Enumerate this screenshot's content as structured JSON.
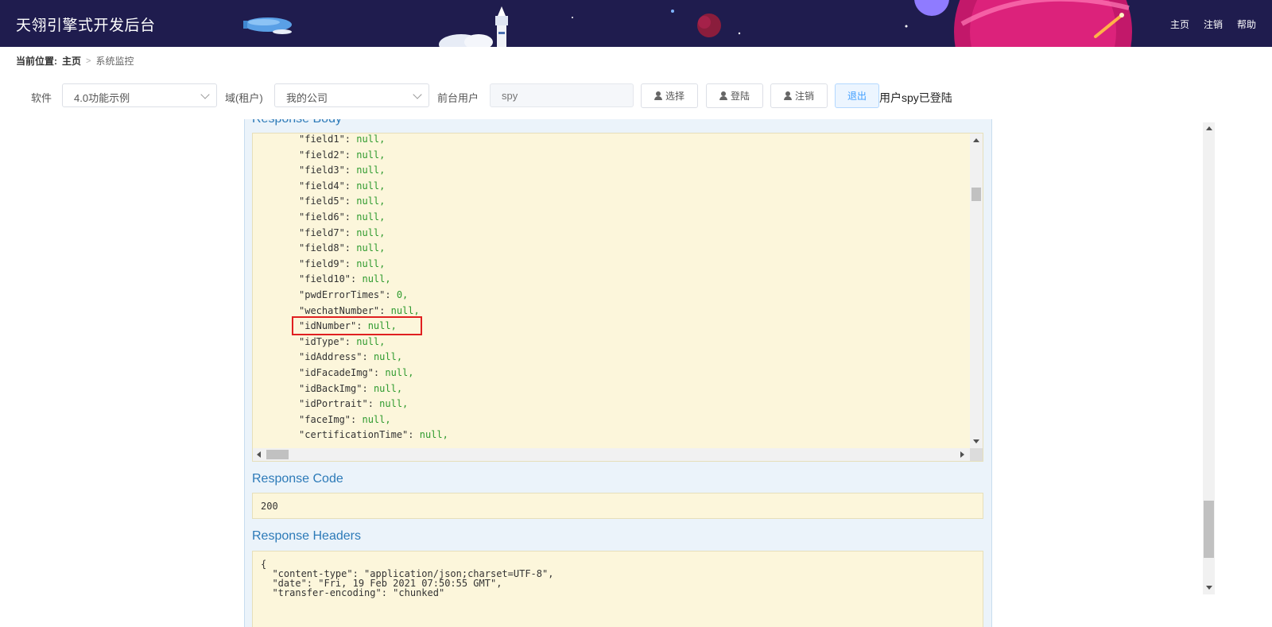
{
  "header": {
    "title": "天翎引擎式开发后台",
    "nav": [
      "主页",
      "注销",
      "帮助"
    ],
    "bg_color": "#1f1c4e"
  },
  "breadcrumb": {
    "prefix": "当前位置:",
    "home": "主页",
    "current": "系统监控"
  },
  "toolbar": {
    "software_label": "软件",
    "software_value": "4.0功能示例",
    "domain_label": "域(租户)",
    "domain_value": "我的公司",
    "frontend_user_label": "前台用户",
    "user_input_placeholder": "spy",
    "select_button": "选择",
    "login_button": "登陆",
    "logout_button": "注销",
    "exit_button": "退出",
    "status_text": "用户spy已登陆"
  },
  "response_body": {
    "title": "Response Body",
    "lines": [
      {
        "key": "\"field1\"",
        "value": "null,"
      },
      {
        "key": "\"field2\"",
        "value": "null,"
      },
      {
        "key": "\"field3\"",
        "value": "null,"
      },
      {
        "key": "\"field4\"",
        "value": "null,"
      },
      {
        "key": "\"field5\"",
        "value": "null,"
      },
      {
        "key": "\"field6\"",
        "value": "null,"
      },
      {
        "key": "\"field7\"",
        "value": "null,"
      },
      {
        "key": "\"field8\"",
        "value": "null,"
      },
      {
        "key": "\"field9\"",
        "value": "null,"
      },
      {
        "key": "\"field10\"",
        "value": "null,"
      },
      {
        "key": "\"pwdErrorTimes\"",
        "value": "0,"
      },
      {
        "key": "\"wechatNumber\"",
        "value": "null,"
      },
      {
        "key": "\"idNumber\"",
        "value": "null,"
      },
      {
        "key": "\"idType\"",
        "value": "null,"
      },
      {
        "key": "\"idAddress\"",
        "value": "null,"
      },
      {
        "key": "\"idFacadeImg\"",
        "value": "null,"
      },
      {
        "key": "\"idBackImg\"",
        "value": "null,"
      },
      {
        "key": "\"idPortrait\"",
        "value": "null,"
      },
      {
        "key": "\"faceImg\"",
        "value": "null,"
      },
      {
        "key": "\"certificationTime\"",
        "value": "null,"
      }
    ]
  },
  "response_code": {
    "title": "Response Code",
    "value": "200"
  },
  "response_headers": {
    "title": "Response Headers",
    "lines": [
      "{",
      "  \"content-type\": \"application/json;charset=UTF-8\",",
      "  \"date\": \"Fri, 19 Feb 2021 07:50:55 GMT\",",
      "  \"transfer-encoding\": \"chunked\""
    ]
  },
  "colors": {
    "accent": "#2c7ab8",
    "code_bg": "#fcf6db",
    "json_value": "#2e9a2e",
    "highlight": "#e02020"
  }
}
